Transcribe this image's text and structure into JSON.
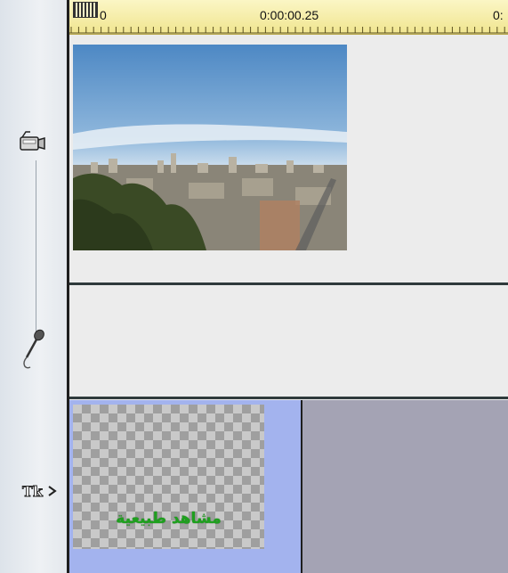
{
  "ruler": {
    "timecodes": [
      "0",
      "0:00:00.25",
      "0:"
    ]
  },
  "tracks": {
    "video": {
      "icon": "video-camera-icon"
    },
    "audio": {
      "icon": "microphone-icon"
    },
    "title": {
      "icon": "title-text-icon",
      "icon_text": "Tk",
      "clip_text": "مشاهد طبيعية",
      "clip_text_color": "#1ea01e"
    }
  },
  "colors": {
    "ruler_bg": "#f6eeaa",
    "title_clip_bg": "#a3b3ee",
    "title_track_bg": "#a4a3b4"
  }
}
